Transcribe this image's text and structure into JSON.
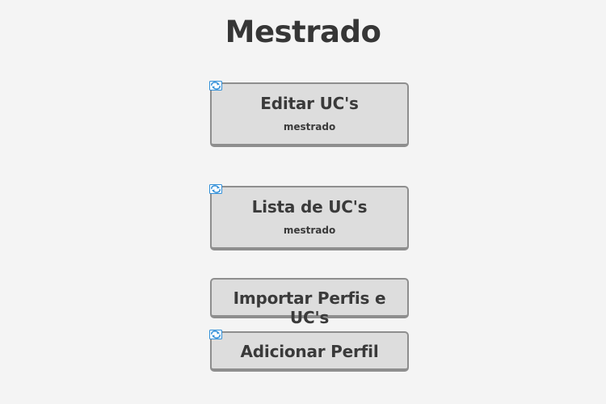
{
  "page": {
    "title": "Mestrado"
  },
  "buttons": {
    "edit_ucs": {
      "label": "Editar UC's",
      "sub": "mestrado"
    },
    "list_ucs": {
      "label": "Lista de UC's",
      "sub": "mestrado"
    },
    "import": {
      "label": "Importar Perfis e UC's"
    },
    "add_profile": {
      "label": "Adicionar Perfil"
    }
  },
  "icons": {
    "refresh": "refresh-icon"
  },
  "colors": {
    "background": "#f4f4f4",
    "button_bg": "#dddddd",
    "button_border": "#8e8e8e",
    "text": "#363636",
    "icon_blue": "#2f8ed8"
  }
}
